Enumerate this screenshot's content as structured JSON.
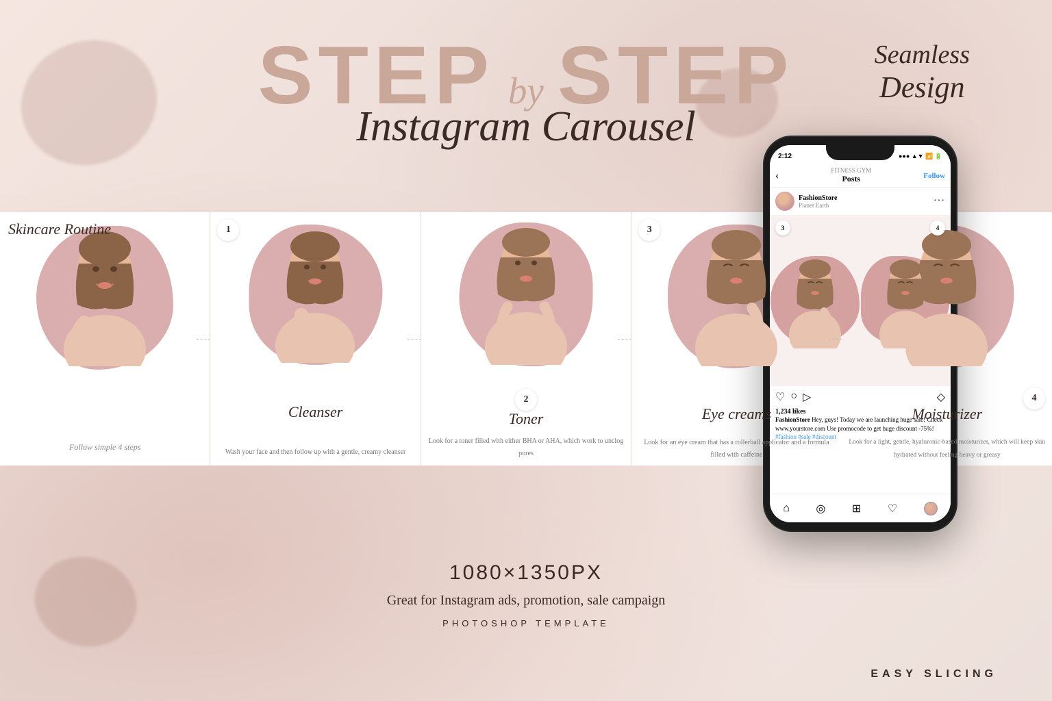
{
  "page": {
    "background": "#f0e0da"
  },
  "header": {
    "title_part1": "STEP",
    "title_by": "by",
    "title_part2": "STEP",
    "subtitle": "Instagram Carousel",
    "seamless_line1": "Seamless",
    "seamless_line2": "Design"
  },
  "carousel": {
    "panels": [
      {
        "id": 0,
        "type": "intro",
        "title": "Skincare Routine",
        "subtitle": "Follow simple 4 steps",
        "step_number": null
      },
      {
        "id": 1,
        "type": "step",
        "title": "Cleanser",
        "description": "Wash your face and then follow up with a gentle, creamy cleanser",
        "step_number": "1"
      },
      {
        "id": 2,
        "type": "step",
        "title": "Toner",
        "description": "Look for a toner filled with either BHA or AHA, which work to unclog pores",
        "step_number": "2"
      },
      {
        "id": 3,
        "type": "step",
        "title": "Eye creams",
        "description": "Look for an eye cream that has a rollerball applicator and a formula filled with caffeine",
        "step_number": "3"
      },
      {
        "id": 4,
        "type": "step",
        "title": "Moisturizer",
        "description": "Look for a light, gentle, hyaluronic-based moisturizer, which will keep skin hydrated without feeling heavy or greasy",
        "step_number": "4"
      }
    ]
  },
  "bottom": {
    "dimensions": "1080×1350PX",
    "promo_text": "Great for Instagram ads, promotion, sale campaign",
    "template_type": "PHOTOSHOP TEMPLATE"
  },
  "phone": {
    "status_time": "2:12",
    "status_signal": "●●●",
    "instagram_account": "FITNESS GYM",
    "posts_label": "Posts",
    "follow_label": "Follow",
    "profile_name": "FashionStore",
    "profile_location": "Planet Earth",
    "likes_count": "1,234 likes",
    "caption": "Hey, guys! Today we are launching huge sale! Check www.yourstore.com Use promocode to get huge discount -75%!",
    "hashtags": "#fashion #sale #discount",
    "slides": [
      {
        "step": "3",
        "title": "Eye creams"
      },
      {
        "step": "4",
        "title": "Moisturizer"
      }
    ]
  },
  "footer": {
    "easy_slicing": "EASY SLICING"
  }
}
